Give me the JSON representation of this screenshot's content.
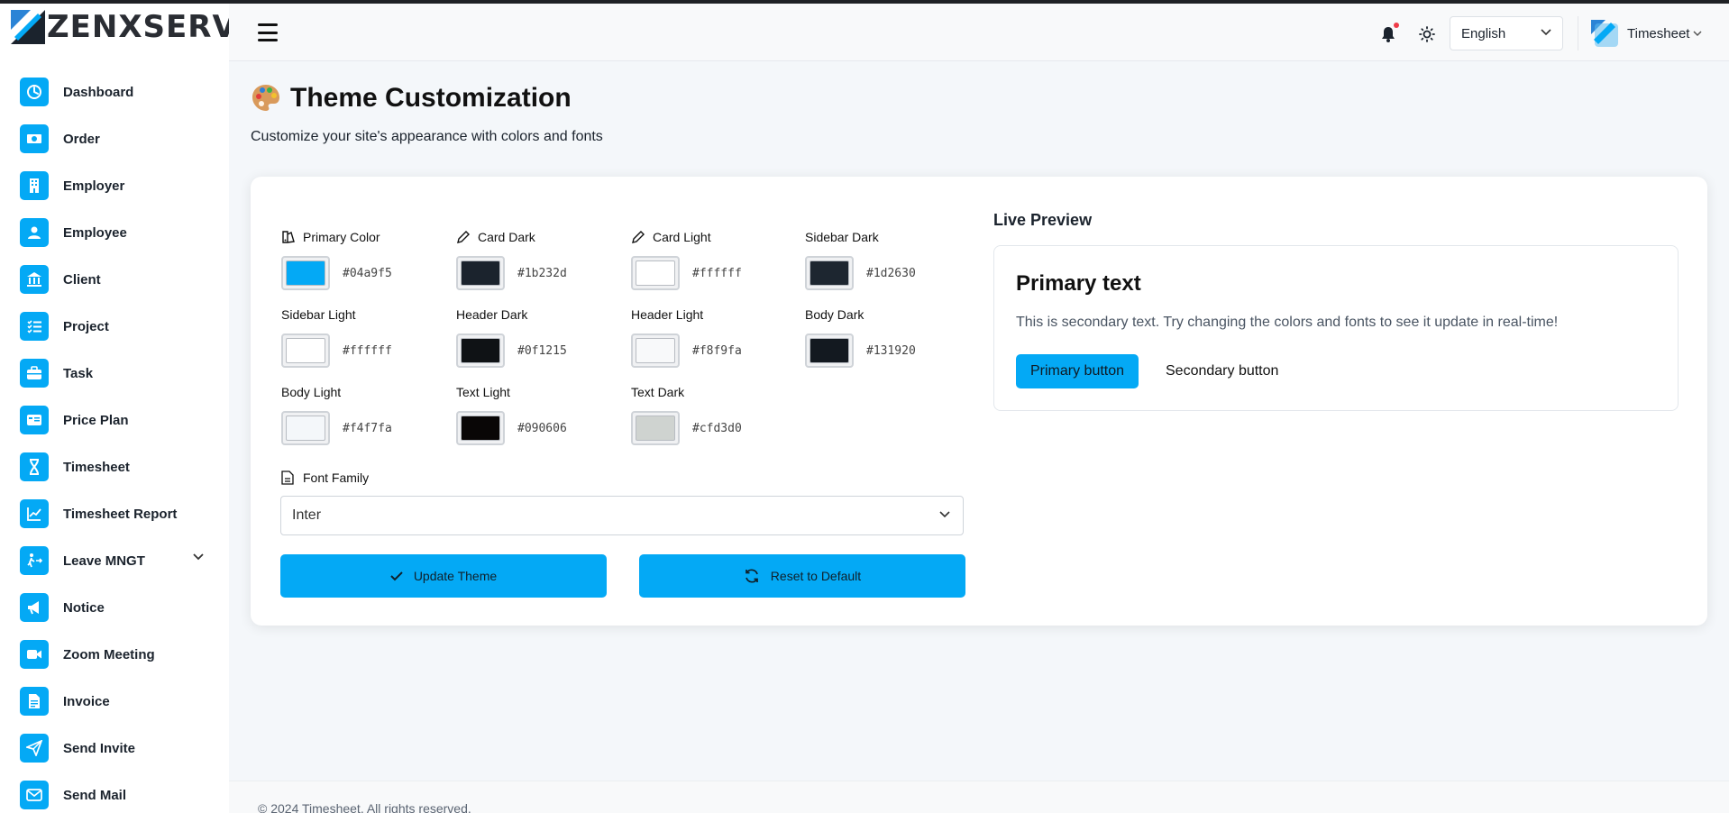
{
  "brand": {
    "name": "ZENXSERV"
  },
  "sidebar": {
    "items": [
      {
        "label": "Dashboard",
        "icon": "dashboard-icon"
      },
      {
        "label": "Order",
        "icon": "money-icon"
      },
      {
        "label": "Employer",
        "icon": "building-icon"
      },
      {
        "label": "Employee",
        "icon": "user-icon"
      },
      {
        "label": "Client",
        "icon": "bank-icon"
      },
      {
        "label": "Project",
        "icon": "checklist-icon"
      },
      {
        "label": "Task",
        "icon": "briefcase-icon"
      },
      {
        "label": "Price Plan",
        "icon": "id-card-icon"
      },
      {
        "label": "Timesheet",
        "icon": "hourglass-icon"
      },
      {
        "label": "Timesheet Report",
        "icon": "chart-line-icon"
      },
      {
        "label": "Leave MNGT",
        "icon": "exit-icon",
        "expandable": true
      },
      {
        "label": "Notice",
        "icon": "megaphone-icon"
      },
      {
        "label": "Zoom Meeting",
        "icon": "video-icon"
      },
      {
        "label": "Invoice",
        "icon": "invoice-icon"
      },
      {
        "label": "Send Invite",
        "icon": "send-icon"
      },
      {
        "label": "Send Mail",
        "icon": "mail-icon"
      }
    ]
  },
  "header": {
    "language": "English",
    "user_name": "Timesheet",
    "notification_indicator": true
  },
  "page": {
    "title": "Theme Customization",
    "subtitle": "Customize your site's appearance with colors and fonts"
  },
  "colors": {
    "primary_color": {
      "label": "Primary Color",
      "value": "#04a9f5"
    },
    "card_dark": {
      "label": "Card Dark",
      "value": "#1b232d"
    },
    "card_light": {
      "label": "Card Light",
      "value": "#ffffff"
    },
    "sidebar_dark": {
      "label": "Sidebar Dark",
      "value": "#1d2630"
    },
    "sidebar_light": {
      "label": "Sidebar Light",
      "value": "#ffffff"
    },
    "header_dark": {
      "label": "Header Dark",
      "value": "#0f1215"
    },
    "header_light": {
      "label": "Header Light",
      "value": "#f8f9fa"
    },
    "body_dark": {
      "label": "Body Dark",
      "value": "#131920"
    },
    "body_light": {
      "label": "Body Light",
      "value": "#f4f7fa"
    },
    "text_light": {
      "label": "Text Light",
      "value": "#090606"
    },
    "text_dark": {
      "label": "Text Dark",
      "value": "#cfd3d0"
    }
  },
  "font": {
    "label": "Font Family",
    "selected": "Inter"
  },
  "actions": {
    "update": "Update Theme",
    "reset": "Reset to Default"
  },
  "preview": {
    "title": "Live Preview",
    "primary_text": "Primary text",
    "secondary_text": "This is secondary text. Try changing the colors and fonts to see it update in real-time!",
    "primary_button": "Primary button",
    "secondary_button": "Secondary button"
  },
  "footer": {
    "text": "© 2024 Timesheet. All rights reserved."
  }
}
